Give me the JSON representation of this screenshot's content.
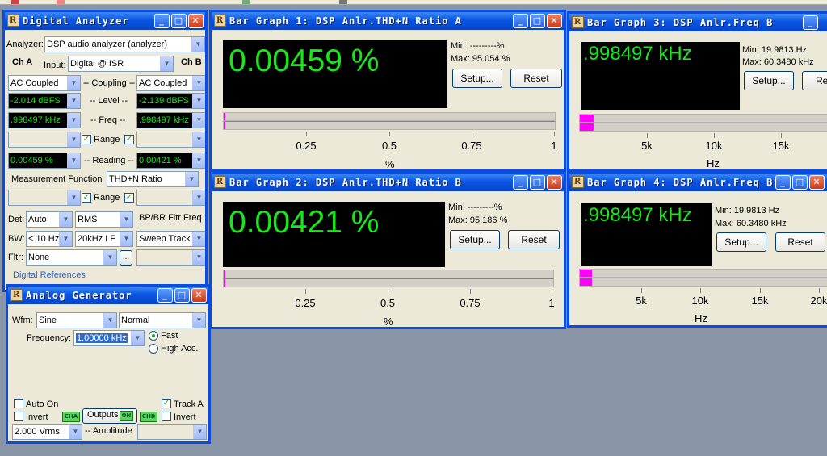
{
  "digital_analyzer": {
    "title": "Digital Analyzer",
    "analyzer_label": "Analyzer:",
    "analyzer_value": "DSP audio analyzer (analyzer)",
    "cha_label": "Ch A",
    "chb_label": "Ch B",
    "input_label": "Input:",
    "input_value": "Digital @ ISR",
    "coupling_a": "AC Coupled",
    "coupling_label": "-- Coupling --",
    "coupling_b": "AC Coupled",
    "level_a": "-2.014  dBFS",
    "level_label": "-- Level --",
    "level_b": "-2.139  dBFS",
    "freq_a": ".998497 kHz",
    "freq_label": "-- Freq --",
    "freq_b": ".998497 kHz",
    "range_label": "Range",
    "reading_a": "0.00459  %",
    "reading_label": "-- Reading --",
    "reading_b": "0.00421  %",
    "measurement_label": "Measurement Function",
    "measurement_value": "THD+N Ratio",
    "range2_label": "Range",
    "det_label": "Det:",
    "det_value": "Auto",
    "det_mode": "RMS",
    "bpbr_label": "BP/BR Fltr Freq",
    "bw_label": "BW:",
    "bw_low": "< 10 Hz",
    "bw_high": "20kHz LP",
    "bw_track": "Sweep Track",
    "fltr_label": "Fltr:",
    "fltr_value": "None",
    "fltr_button": "...",
    "digital_refs": "Digital References"
  },
  "analog_generator": {
    "title": "Analog Generator",
    "wfm_label": "Wfm:",
    "wfm_value": "Sine",
    "wfm_mode": "Normal",
    "frequency_label": "Frequency:",
    "frequency_value": "1.00000 kHz",
    "fast_label": "Fast",
    "high_acc_label": "High Acc.",
    "auto_on_label": "Auto On",
    "track_a_label": "Track A",
    "invert_a_label": "Invert",
    "invert_b_label": "Invert",
    "cha_led": "CHA",
    "chb_led": "CHB",
    "outputs_label": "Outputs",
    "outputs_led": "ON",
    "amplitude_value": "2.000  Vrms",
    "amplitude_label": "-- Amplitude"
  },
  "bar_graph_1": {
    "title": "Bar Graph 1: DSP Anlr.THD+N Ratio A",
    "reading": "0.00459  %",
    "min": "Min: ---------%",
    "max": "Max: 95.054  %",
    "setup": "Setup...",
    "reset": "Reset",
    "ticks": [
      "0.25",
      "0.5",
      "0.75",
      "1"
    ],
    "unit": "%",
    "bar_fraction": 0.0046
  },
  "bar_graph_2": {
    "title": "Bar Graph 2: DSP Anlr.THD+N Ratio B",
    "reading": "0.00421  %",
    "min": "Min: ---------%",
    "max": "Max: 95.186  %",
    "setup": "Setup...",
    "reset": "Reset",
    "ticks": [
      "0.25",
      "0.5",
      "0.75",
      "1"
    ],
    "unit": "%",
    "bar_fraction": 0.0042
  },
  "bar_graph_3": {
    "title": "Bar Graph 3: DSP Anlr.Freq B",
    "reading": ".998497 kHz",
    "min": "Min: 19.9813  Hz",
    "max": "Max: 60.3480 kHz",
    "setup": "Setup...",
    "reset": "Reset",
    "ticks": [
      "5k",
      "10k",
      "15k"
    ],
    "unit": "Hz",
    "bar_value_hz": 998.497
  },
  "bar_graph_4": {
    "title": "Bar Graph 4: DSP Anlr.Freq B",
    "reading": ".998497 kHz",
    "min": "Min: 19.9813  Hz",
    "max": "Max: 60.3480 kHz",
    "setup": "Setup...",
    "reset": "Reset",
    "ticks": [
      "5k",
      "10k",
      "15k",
      "20k"
    ],
    "unit": "Hz",
    "bar_value_hz": 998.497
  },
  "colors": {
    "readout_green": "#17e817",
    "title_blue": "#0a55e4",
    "bar_magenta": "#ff00ff"
  }
}
